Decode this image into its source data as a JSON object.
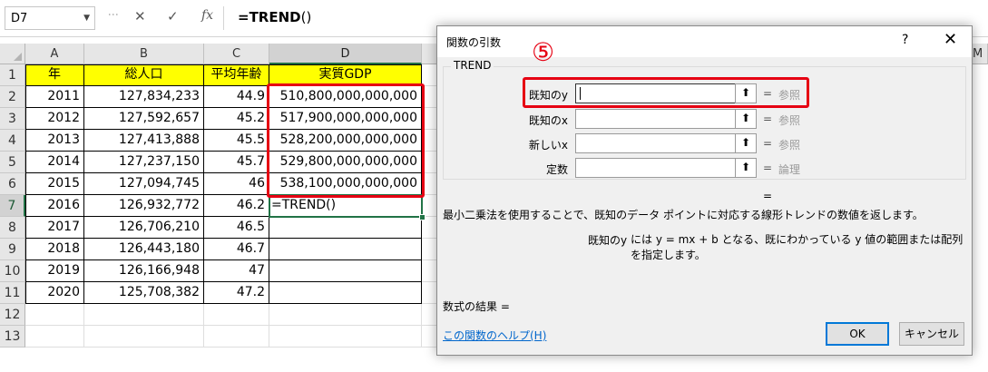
{
  "formula_bar": {
    "name_box": "D7",
    "fx_label": "fx",
    "formula_main": "=TREND",
    "formula_parens": "()"
  },
  "sheet": {
    "columns": [
      "A",
      "B",
      "C",
      "D"
    ],
    "partial_column_right": "M",
    "rows": [
      "1",
      "2",
      "3",
      "4",
      "5",
      "6",
      "7",
      "8",
      "9",
      "10",
      "11",
      "12",
      "13"
    ],
    "headers": [
      "年",
      "総人口",
      "平均年齢",
      "実質GDP"
    ],
    "data": [
      [
        "2011",
        "127,834,233",
        "44.9",
        "510,800,000,000,000"
      ],
      [
        "2012",
        "127,592,657",
        "45.2",
        "517,900,000,000,000"
      ],
      [
        "2013",
        "127,413,888",
        "45.5",
        "528,200,000,000,000"
      ],
      [
        "2014",
        "127,237,150",
        "45.7",
        "529,800,000,000,000"
      ],
      [
        "2015",
        "127,094,745",
        "46",
        "538,100,000,000,000"
      ],
      [
        "2016",
        "126,932,772",
        "46.2",
        "=TREND()"
      ],
      [
        "2017",
        "126,706,210",
        "46.5",
        ""
      ],
      [
        "2018",
        "126,443,180",
        "46.7",
        ""
      ],
      [
        "2019",
        "126,166,948",
        "47",
        ""
      ],
      [
        "2020",
        "125,708,382",
        "47.2",
        ""
      ]
    ]
  },
  "dialog": {
    "title": "関数の引数",
    "help": "?",
    "close": "✕",
    "function_name": "TREND",
    "args": [
      {
        "label": "既知のy",
        "eq": "=",
        "hint": "参照"
      },
      {
        "label": "既知のx",
        "eq": "=",
        "hint": "参照"
      },
      {
        "label": "新しいx",
        "eq": "=",
        "hint": "参照"
      },
      {
        "label": "定数",
        "eq": "=",
        "hint": "論理"
      }
    ],
    "result_eq": "=",
    "description": "最小二乗法を使用することで、既知のデータ ポイントに対応する線形トレンドの数値を返します。",
    "arg_name": "既知のy",
    "arg_description": "には y = mx + b となる、既にわかっている y 値の範囲または配列を指定します。",
    "result_label": "数式の結果 =",
    "help_link": "この関数のヘルプ(H)",
    "ok": "OK",
    "cancel": "キャンセル"
  },
  "annotation": {
    "step_number": "⑤",
    "color": "#e60012"
  },
  "colors": {
    "header_fill": "#ffff00",
    "selection_green": "#217346"
  }
}
